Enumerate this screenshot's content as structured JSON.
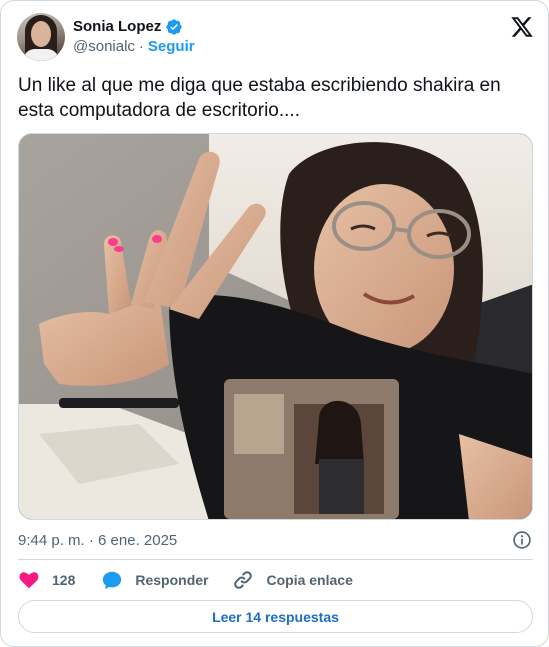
{
  "author": {
    "display_name": "Sonia Lopez",
    "handle": "@sonialc",
    "separator": "·",
    "follow_label": "Seguir",
    "verified": true
  },
  "tweet": {
    "text": "Un like al que me diga que estaba escribiendo shakira en esta computadora de escritorio....",
    "timestamp": "9:44 p. m. · 6 ene. 2025"
  },
  "actions": {
    "likes_count": "128",
    "reply_label": "Responder",
    "copy_link_label": "Copia enlace"
  },
  "replies_button": {
    "label": "Leer 14 respuestas"
  },
  "colors": {
    "accent": "#1d9bf0",
    "like": "#f91880",
    "text": "#0f1419",
    "muted": "#536471",
    "border": "#cfd9de"
  },
  "icons": {
    "brand": "x-logo-icon",
    "verified": "verified-badge-icon",
    "info": "info-icon",
    "like": "heart-icon",
    "reply": "speech-bubble-icon",
    "copy": "link-icon"
  }
}
